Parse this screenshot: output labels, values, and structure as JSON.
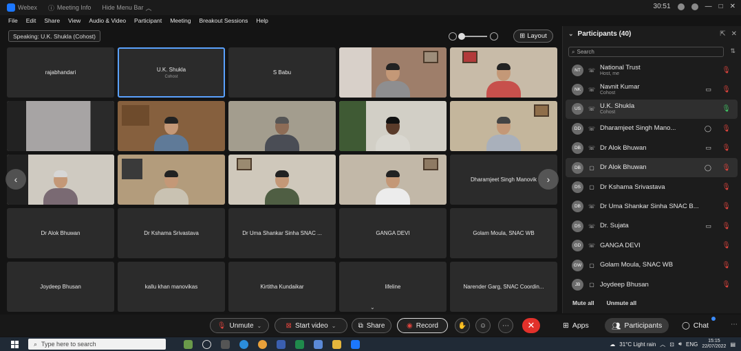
{
  "titlebar": {
    "app": "Webex",
    "meeting_info": "Meeting Info",
    "hide_menu": "Hide Menu Bar",
    "time": "30:51"
  },
  "menu": [
    "File",
    "Edit",
    "Share",
    "View",
    "Audio & Video",
    "Participant",
    "Meeting",
    "Breakout Sessions",
    "Help"
  ],
  "speaking": "Speaking: U.K. Shukla (Cohost)",
  "layout_label": "Layout",
  "tiles": [
    {
      "name": "rajabhandari",
      "role": ""
    },
    {
      "name": "U.K. Shukla",
      "role": "Cohost"
    },
    {
      "name": "S Babu",
      "role": ""
    },
    {
      "name": "Dharamjeet Singh Manovik",
      "role": ""
    },
    {
      "name": "Dr Alok Bhuwan",
      "role": ""
    },
    {
      "name": "Dr Kshama Srivastava",
      "role": ""
    },
    {
      "name": "Dr Uma Shankar Sinha SNAC ...",
      "role": ""
    },
    {
      "name": "GANGA DEVI",
      "role": ""
    },
    {
      "name": "Golam Moula, SNAC WB",
      "role": ""
    },
    {
      "name": "Joydeep Bhusan",
      "role": ""
    },
    {
      "name": "kallu khan manovikas",
      "role": ""
    },
    {
      "name": "Kirtitha Kundaikar",
      "role": ""
    },
    {
      "name": "lifeline",
      "role": ""
    },
    {
      "name": "Narender Garg, SNAC Coordin...",
      "role": ""
    }
  ],
  "toolbar": {
    "unmute": "Unmute",
    "start_video": "Start video",
    "share": "Share",
    "record": "Record",
    "apps": "Apps",
    "participants": "Participants",
    "chat": "Chat"
  },
  "panel": {
    "title": "Participants (40)",
    "search_placeholder": "Search",
    "participants": [
      {
        "initials": "NT",
        "name": "National Trust",
        "sub": "Host, me",
        "type": "phone",
        "video": false,
        "muted": true
      },
      {
        "initials": "NK",
        "name": "Navnit Kumar",
        "sub": "Cohost",
        "type": "phone",
        "video": true,
        "muted": true
      },
      {
        "initials": "US",
        "name": "U.K. Shukla",
        "sub": "Cohost",
        "type": "phone",
        "video": false,
        "muted": false
      },
      {
        "initials": "DD",
        "name": "Dharamjeet Singh Mano...",
        "sub": "",
        "type": "phone",
        "video": false,
        "muted": true
      },
      {
        "initials": "DB",
        "name": "Dr Alok Bhuwan",
        "sub": "",
        "type": "phone",
        "video": true,
        "muted": true
      },
      {
        "initials": "DB",
        "name": "Dr Alok Bhuwan",
        "sub": "",
        "type": "screen",
        "video": false,
        "muted": true
      },
      {
        "initials": "DS",
        "name": "Dr Kshama Srivastava",
        "sub": "",
        "type": "screen",
        "video": false,
        "muted": true
      },
      {
        "initials": "DB",
        "name": "Dr Uma Shankar Sinha SNAC B...",
        "sub": "",
        "type": "phone",
        "video": false,
        "muted": true
      },
      {
        "initials": "DS",
        "name": "Dr. Sujata",
        "sub": "",
        "type": "phone",
        "video": true,
        "muted": true
      },
      {
        "initials": "GD",
        "name": "GANGA DEVI",
        "sub": "",
        "type": "phone",
        "video": false,
        "muted": true
      },
      {
        "initials": "GW",
        "name": "Golam Moula, SNAC WB",
        "sub": "",
        "type": "screen",
        "video": false,
        "muted": true
      },
      {
        "initials": "JB",
        "name": "Joydeep Bhusan",
        "sub": "",
        "type": "screen",
        "video": false,
        "muted": true
      }
    ],
    "mute_all": "Mute all",
    "unmute_all": "Unmute all"
  },
  "taskbar": {
    "search_placeholder": "Type here to search",
    "weather": "31°C Light rain",
    "lang": "ENG",
    "time": "15:15",
    "date": "22/07/2022"
  },
  "colors": {
    "accent": "#5aa2ff",
    "danger": "#e2312b",
    "muted_icon": "#e0443d",
    "unmuted_icon": "#40c463"
  }
}
